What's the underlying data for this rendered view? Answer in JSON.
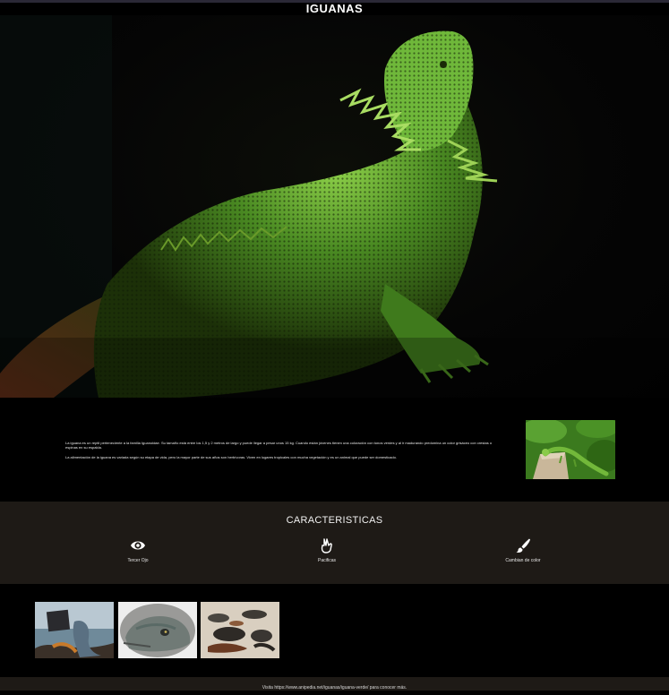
{
  "header": {
    "title": "IGUANAS"
  },
  "hero": {
    "image": "bearded-lizard-photo"
  },
  "intro": {
    "paragraphs": [
      "La iguana es un reptil perteneciente a la familia Iguanoidae. Su tamaño está entre los 1,5 y 2 metros de largo y puede llegar a pesar unos 15 kg. Cuando están jóvenes tienen una coloración con tonos verdes y al ir madurando predomina un color grisáceo con crestas o espinas en su espalda.",
      "La alimentación de la iguana es variada según su etapa de vida, pero la mayor parte de sus años son herbívoras. Viven en lugares tropicales con mucha vegetación y es un animal que puede ser domesticado."
    ],
    "photo": "green-iguana-on-stump-photo"
  },
  "features": {
    "title": "CARACTERISTICAS",
    "items": [
      {
        "icon": "eye-icon",
        "label": "Tercer Ojo"
      },
      {
        "icon": "peace-hand-icon",
        "label": "Pacificas"
      },
      {
        "icon": "paint-brush-icon",
        "label": "Cambian de color"
      }
    ]
  },
  "gallery": {
    "images": [
      "iguana-on-rock-by-sea-photo",
      "iguana-head-closeup-photo",
      "marine-iguanas-on-beach-photo"
    ]
  },
  "footer": {
    "text": "Visita https://www.anipedia.net/iguanas/iguana-verde/ para conocer más."
  },
  "colors": {
    "background": "#000000",
    "band": "#1e1a16",
    "text": "#ffffff"
  }
}
